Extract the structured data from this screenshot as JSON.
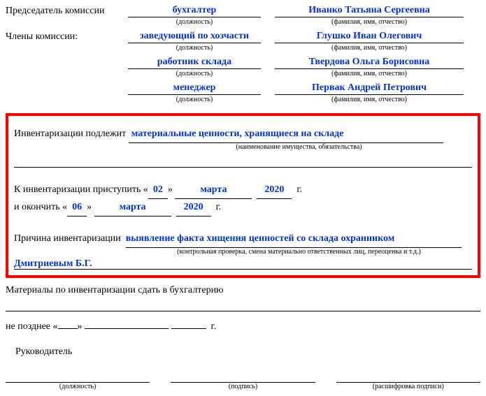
{
  "commission": {
    "chair_label": "Председатель комиссии",
    "members_label": "Члены комиссии:",
    "pos_sub": "(должность)",
    "name_sub": "(фамилия, имя, отчество)",
    "chair": {
      "position": "бухгалтер",
      "name": "Иванко Татьяна Сергеевна"
    },
    "members": [
      {
        "position": "заведующий по хозчасти",
        "name": "Глушко Иван Олегович"
      },
      {
        "position": "работник склада",
        "name": "Твердова Ольга Борисовна"
      },
      {
        "position": "менеджер",
        "name": "Первак Андрей Петрович"
      }
    ]
  },
  "subject": {
    "label": "Инвентаризации подлежит",
    "value": "материальные ценности, хранящиеся на складе",
    "sub": "(наименование имущества, обязательства)"
  },
  "dates": {
    "start_label": "К инвентаризации приступить",
    "end_label": "и окончить",
    "year_suffix": "г.",
    "start": {
      "day": "02",
      "month": "марта",
      "year": "2020"
    },
    "end": {
      "day": "06",
      "month": "марта",
      "year": "2020"
    }
  },
  "reason": {
    "label": "Причина инвентаризации",
    "line1": "выявление факта хищения ценностей со склада охранником",
    "sub": "(контрольная проверка, смена материально ответственных лиц, переоценка и т.д.)",
    "line2": "Дмитриевым Б.Г."
  },
  "materials": {
    "label": "Материалы по инвентаризации сдать в бухгалтерию",
    "deadline": "не позднее",
    "year_suffix": "г."
  },
  "signer": {
    "label": "Руководитель",
    "pos_sub": "(должность)",
    "sign_sub": "(подпись)",
    "decode_sub": "(расшифровка подписи)"
  }
}
